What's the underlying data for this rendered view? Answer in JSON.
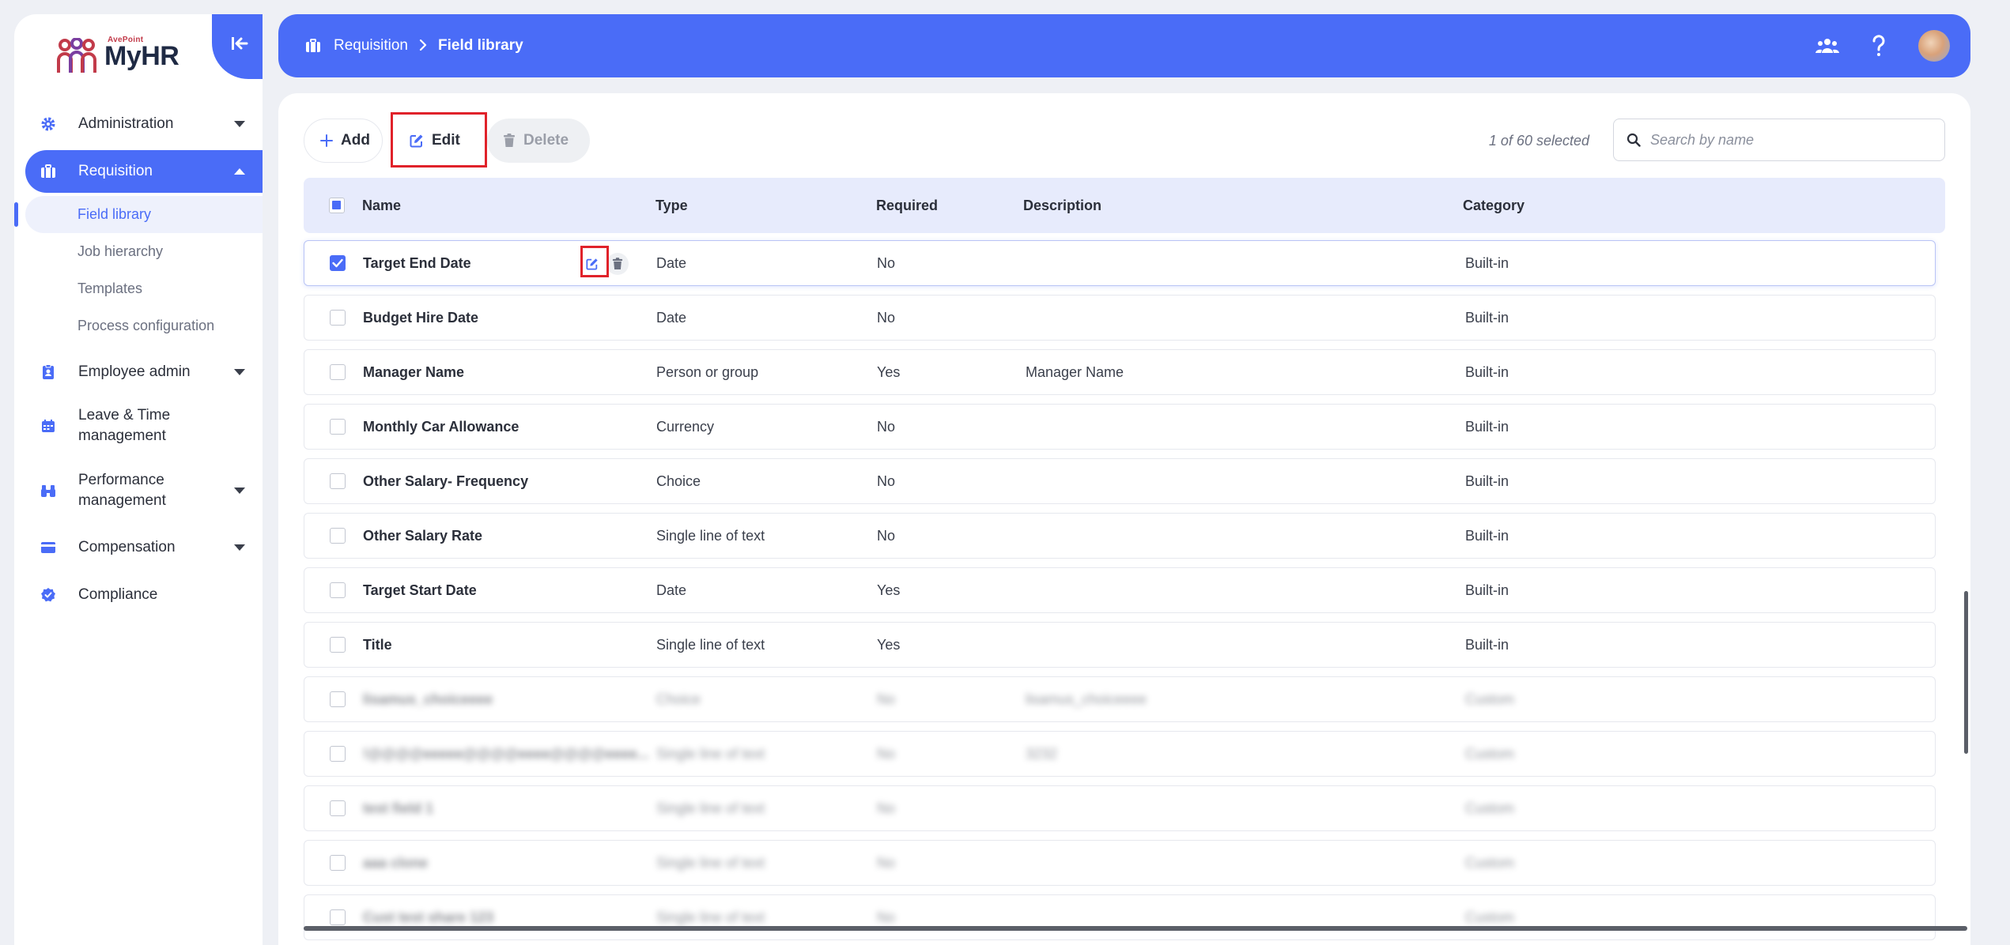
{
  "app": {
    "brand_top": "AvePoint",
    "brand_name": "MyHR"
  },
  "sidebar": {
    "items": [
      {
        "label": "Administration"
      },
      {
        "label": "Requisition"
      },
      {
        "label": "Employee admin"
      },
      {
        "label": "Leave & Time management"
      },
      {
        "label": "Performance management"
      },
      {
        "label": "Compensation"
      },
      {
        "label": "Compliance"
      }
    ],
    "requisition_sub": [
      {
        "label": "Field library"
      },
      {
        "label": "Job hierarchy"
      },
      {
        "label": "Templates"
      },
      {
        "label": "Process configuration"
      }
    ]
  },
  "header": {
    "breadcrumb_root": "Requisition",
    "breadcrumb_current": "Field library"
  },
  "toolbar": {
    "add_label": "Add",
    "edit_label": "Edit",
    "delete_label": "Delete",
    "selection_text": "1 of 60 selected",
    "search_placeholder": "Search by name"
  },
  "table": {
    "columns": [
      "Name",
      "Type",
      "Required",
      "Description",
      "Category"
    ],
    "rows": [
      {
        "name": "Target End Date",
        "type": "Date",
        "required": "No",
        "description": "",
        "category": "Built-in",
        "selected": true
      },
      {
        "name": "Budget Hire Date",
        "type": "Date",
        "required": "No",
        "description": "",
        "category": "Built-in"
      },
      {
        "name": "Manager Name",
        "type": "Person or group",
        "required": "Yes",
        "description": "Manager Name",
        "category": "Built-in"
      },
      {
        "name": "Monthly Car Allowance",
        "type": "Currency",
        "required": "No",
        "description": "",
        "category": "Built-in"
      },
      {
        "name": "Other Salary- Frequency",
        "type": "Choice",
        "required": "No",
        "description": "",
        "category": "Built-in"
      },
      {
        "name": "Other Salary Rate",
        "type": "Single line of text",
        "required": "No",
        "description": "",
        "category": "Built-in"
      },
      {
        "name": "Target Start Date",
        "type": "Date",
        "required": "Yes",
        "description": "",
        "category": "Built-in"
      },
      {
        "name": "Title",
        "type": "Single line of text",
        "required": "Yes",
        "description": "",
        "category": "Built-in"
      },
      {
        "name": "lisamus_choiceeee",
        "type": "Choice",
        "required": "No",
        "description": "lisamus_choiceeee",
        "category": "Custom",
        "blurred": true
      },
      {
        "name": "!@@@@eeeee@@@@eeee@@@@eeee...",
        "type": "Single line of text",
        "required": "No",
        "description": "3232",
        "category": "Custom",
        "blurred": true
      },
      {
        "name": "test field 1",
        "type": "Single line of text",
        "required": "No",
        "description": "",
        "category": "Custom",
        "blurred": true
      },
      {
        "name": "aaa clone",
        "type": "Single line of text",
        "required": "No",
        "description": "",
        "category": "Custom",
        "blurred": true
      },
      {
        "name": "Cust test share 123",
        "type": "Single line of text",
        "required": "No",
        "description": "",
        "category": "Custom",
        "blurred": true
      }
    ]
  },
  "colors": {
    "accent": "#4a6cf7",
    "highlight": "#e0222a"
  }
}
